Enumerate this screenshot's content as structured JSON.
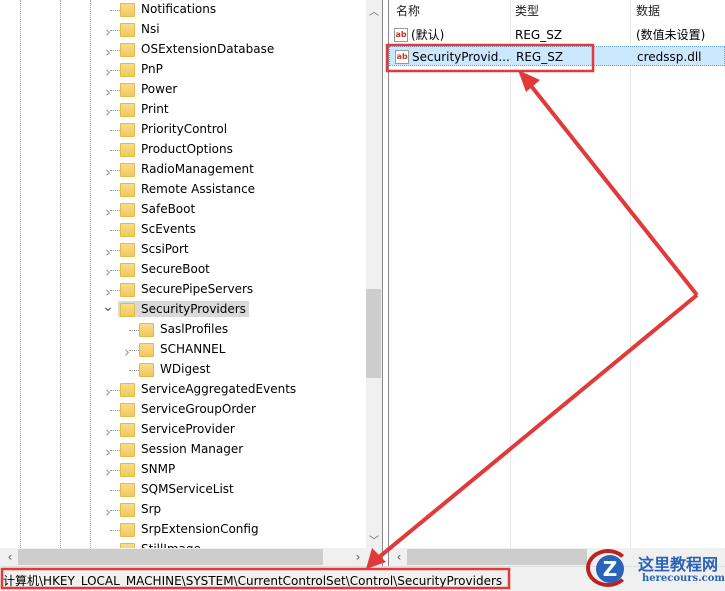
{
  "tree": {
    "items": [
      {
        "label": "Notifications",
        "expandable": false
      },
      {
        "label": "Nsi",
        "expandable": true
      },
      {
        "label": "OSExtensionDatabase",
        "expandable": true
      },
      {
        "label": "PnP",
        "expandable": true
      },
      {
        "label": "Power",
        "expandable": true
      },
      {
        "label": "Print",
        "expandable": true
      },
      {
        "label": "PriorityControl",
        "expandable": false
      },
      {
        "label": "ProductOptions",
        "expandable": false
      },
      {
        "label": "RadioManagement",
        "expandable": true
      },
      {
        "label": "Remote Assistance",
        "expandable": false
      },
      {
        "label": "SafeBoot",
        "expandable": true
      },
      {
        "label": "ScEvents",
        "expandable": false
      },
      {
        "label": "ScsiPort",
        "expandable": true
      },
      {
        "label": "SecureBoot",
        "expandable": true
      },
      {
        "label": "SecurePipeServers",
        "expandable": true
      },
      {
        "label": "SecurityProviders",
        "expanded": true,
        "selected": true
      },
      {
        "label": "SaslProfiles",
        "child": true,
        "expandable": false
      },
      {
        "label": "SCHANNEL",
        "child": true,
        "expandable": true
      },
      {
        "label": "WDigest",
        "child": true,
        "expandable": false
      },
      {
        "label": "ServiceAggregatedEvents",
        "expandable": true
      },
      {
        "label": "ServiceGroupOrder",
        "expandable": false
      },
      {
        "label": "ServiceProvider",
        "expandable": true
      },
      {
        "label": "Session Manager",
        "expandable": true
      },
      {
        "label": "SNMP",
        "expandable": true
      },
      {
        "label": "SQMServiceList",
        "expandable": false
      },
      {
        "label": "Srp",
        "expandable": true
      },
      {
        "label": "SrpExtensionConfig",
        "expandable": false
      },
      {
        "label": "StillImage",
        "expandable": true
      }
    ]
  },
  "list": {
    "columns": {
      "name": "名称",
      "type": "类型",
      "data": "数据"
    },
    "rows": [
      {
        "name": "(默认)",
        "type": "REG_SZ",
        "data": "(数值未设置)",
        "selected": false
      },
      {
        "name": "SecurityProvid...",
        "type": "REG_SZ",
        "data": "credssp.dll",
        "selected": true
      }
    ]
  },
  "status": {
    "path": "计算机\\HKEY_LOCAL_MACHINE\\SYSTEM\\CurrentControlSet\\Control\\SecurityProviders"
  },
  "watermark": {
    "title": "这里教程网",
    "site": "herecours.com"
  },
  "colors": {
    "annotation": "#e03a3a",
    "selection": "#cce8ff",
    "folder": "#f1c85c"
  }
}
